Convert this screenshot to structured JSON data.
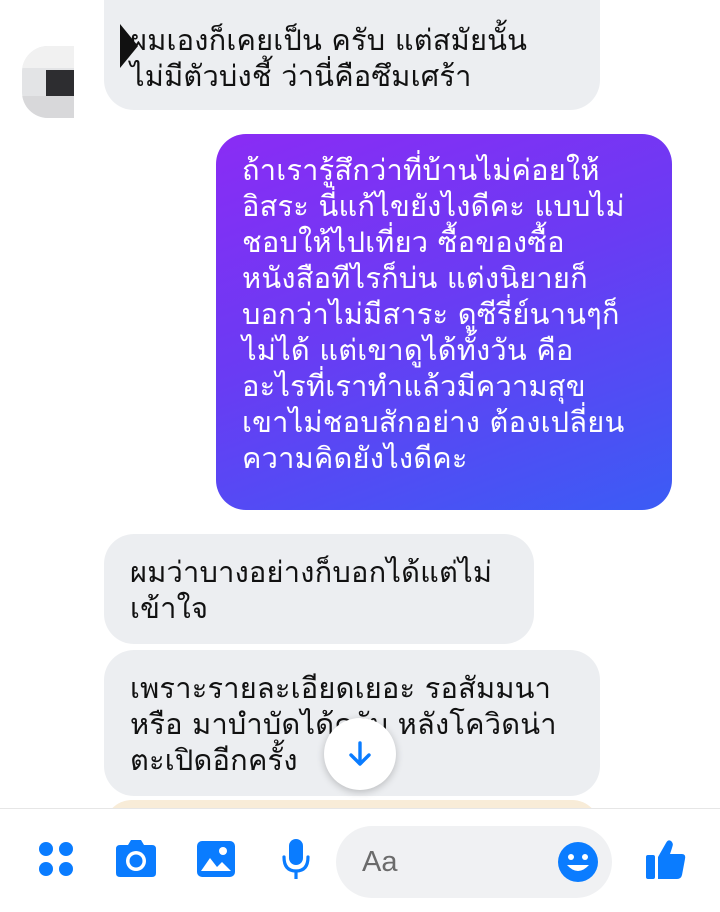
{
  "conversation": {
    "messages": [
      {
        "direction": "incoming",
        "text": "ผมเองก็เคยเป็น ครับ แต่สมัยนั้น\nไม่มีตัวบ่งชี้ ว่านี่คือซึมเศร้า"
      },
      {
        "direction": "outgoing",
        "text": "ถ้าเรารู้สึกว่าที่บ้านไม่ค่อยให้\nอิสระ นี่แก้ไขยังไงดีคะ แบบไม่\nชอบให้ไปเที่ยว ซื้อของซื้อ\nหนังสือทีไรก็บ่น แต่งนิยายก็\nบอกว่าไม่มีสาระ ดูซีรี่ย์นานๆก็\nไม่ได้ แต่เขาดูได้ทั้งวัน คือ\nอะไรที่เราทำแล้วมีความสุข\nเขาไม่ชอบสักอย่าง ต้องเปลี่ยน\nความคิดยังไงดีคะ"
      },
      {
        "direction": "incoming",
        "text": "ผมว่าบางอย่างก็บอกได้แต่ไม่\nเข้าใจ"
      },
      {
        "direction": "incoming",
        "text": "เพราะรายละเอียดเยอะ รอสัมมนา\nหรือ มาบำบัดได้ครับ หลังโควิดน่า\nตะเปิดอีกครั้ง"
      }
    ],
    "colors": {
      "incoming_bubble": "#eceef1",
      "outgoing_gradient_start": "#8a2cf4",
      "outgoing_gradient_end": "#3b5cf5",
      "accent": "#0a7cff"
    },
    "scroll_button_icon": "arrow-down-icon"
  },
  "composer": {
    "placeholder": "Aa",
    "icons": [
      "apps-icon",
      "camera-icon",
      "gallery-icon",
      "microphone-icon",
      "emoji-icon",
      "thumbs-up-icon"
    ]
  }
}
